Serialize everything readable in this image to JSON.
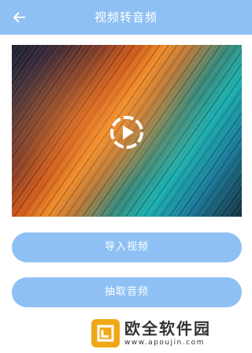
{
  "header": {
    "title": "视频转音频",
    "back_icon": "arrow-left-icon"
  },
  "player": {
    "play_icon": "play-circle-icon"
  },
  "actions": {
    "import_label": "导入视频",
    "extract_label": "抽取音频"
  },
  "watermark": {
    "brand": "欧全软件园",
    "url": "www.apoujin.com",
    "logo_color": "#f0a818"
  },
  "colors": {
    "primary": "#8ec0f4",
    "on_primary": "#ffffff"
  }
}
